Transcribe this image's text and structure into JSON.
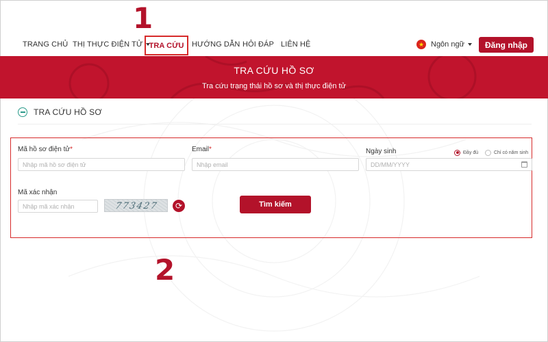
{
  "annotations": {
    "step1": "1",
    "step2": "2"
  },
  "nav": {
    "home": "TRANG CHỦ",
    "evisa": "THỊ THỰC ĐIỆN TỬ",
    "lookup": "TRA CỨU",
    "guide": "HƯỚNG DẪN",
    "faq": "HỎI ĐÁP",
    "contact": "LIÊN HỆ"
  },
  "header": {
    "language": "Ngôn ngữ",
    "login": "Đăng nhập"
  },
  "banner": {
    "title": "TRA CỨU HỒ SƠ",
    "subtitle": "Tra cứu trạng thái hồ sơ và thị thực điện tử"
  },
  "section": {
    "title": "TRA CỨU HỒ SƠ"
  },
  "form": {
    "file_code_label": "Mã hồ sơ điện tử",
    "file_code_placeholder": "Nhập mã hồ sơ điện tử",
    "email_label": "Email",
    "email_placeholder": "Nhập email",
    "dob_label": "Ngày sinh",
    "dob_placeholder": "DD/MM/YYYY",
    "dob_full": "Đầy đủ",
    "dob_year_only": "Chỉ có năm sinh",
    "captcha_label": "Mã xác nhận",
    "captcha_placeholder": "Nhập mã xác nhận",
    "captcha_text": "773427",
    "required_mark": "*",
    "search_button": "Tìm kiếm"
  },
  "colors": {
    "primary": "#c1142d",
    "highlight": "#d62a2a",
    "accent_teal": "#2a9a8a"
  },
  "icons": [
    "vietnam-flag-icon",
    "caret-down-icon",
    "minus-circle-icon",
    "calendar-icon",
    "refresh-icon"
  ]
}
